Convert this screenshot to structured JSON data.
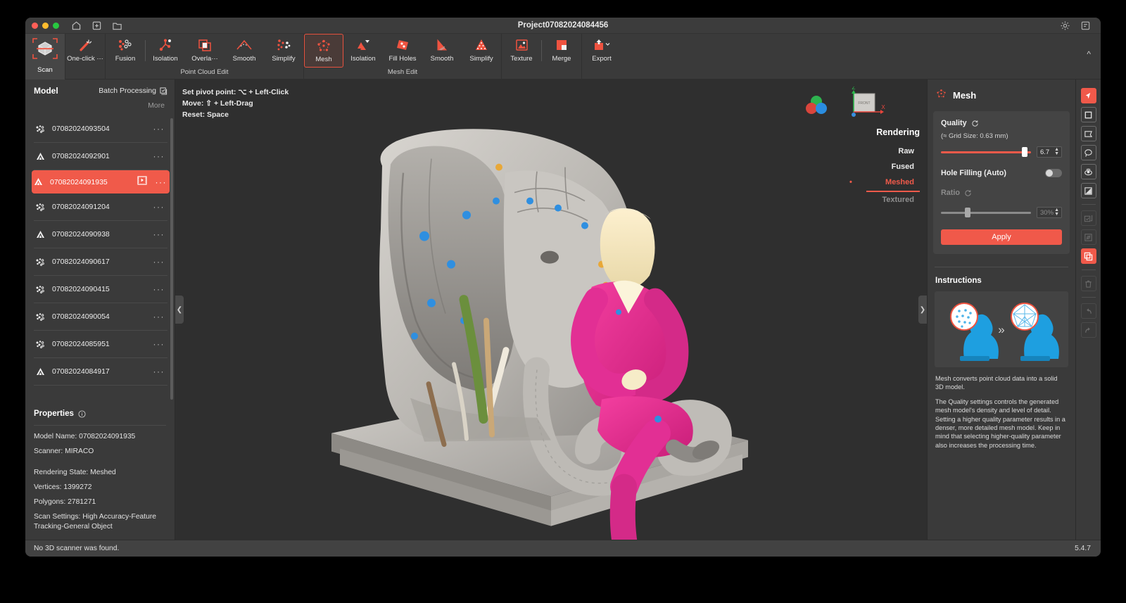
{
  "titlebar": {
    "project_title": "Project07082024084456",
    "icons": [
      "home-icon",
      "add-icon",
      "folder-icon"
    ],
    "right_icons": [
      "gear-icon",
      "note-icon"
    ]
  },
  "ribbon": {
    "scan": {
      "label": "Scan",
      "icon": "scan-cube-icon"
    },
    "groups": [
      {
        "caption": "",
        "items": [
          {
            "label": "One-click ···",
            "icon": "magic-wand-icon"
          }
        ]
      },
      {
        "caption": "Point Cloud Edit",
        "items": [
          {
            "label": "Fusion",
            "icon": "point-fusion-icon"
          },
          {
            "label": "Isolation",
            "icon": "point-isolation-icon"
          },
          {
            "label": "Overla···",
            "icon": "overlap-icon"
          },
          {
            "label": "Smooth",
            "icon": "smooth-curve-icon"
          },
          {
            "label": "Simplify",
            "icon": "simplify-dots-icon"
          }
        ]
      },
      {
        "caption": "Mesh Edit",
        "items": [
          {
            "label": "Mesh",
            "icon": "mesh-node-icon",
            "selected": true
          },
          {
            "label": "Isolation",
            "icon": "mesh-isolation-icon"
          },
          {
            "label": "Fill Holes",
            "icon": "fill-holes-icon"
          },
          {
            "label": "Smooth",
            "icon": "mesh-smooth-icon"
          },
          {
            "label": "Simplify",
            "icon": "mesh-simplify-icon"
          }
        ]
      },
      {
        "caption": "",
        "items": [
          {
            "label": "Texture",
            "icon": "texture-image-icon"
          },
          {
            "label": "Merge",
            "icon": "merge-squares-icon"
          }
        ]
      },
      {
        "caption": "",
        "items": [
          {
            "label": "Export",
            "icon": "export-upload-icon"
          }
        ]
      }
    ],
    "collapse_icon": "chevron-up-icon"
  },
  "left_panel": {
    "title": "Model",
    "batch_label": "Batch Processing",
    "batch_icon": "batch-copy-icon",
    "more_label": "More",
    "models": [
      {
        "name": "07082024093504",
        "type": "point-cloud-icon",
        "selected": false
      },
      {
        "name": "07082024092901",
        "type": "mesh-triangle-icon",
        "selected": false
      },
      {
        "name": "07082024091935",
        "type": "mesh-triangle-icon",
        "selected": true,
        "badge": "video-frame-icon"
      },
      {
        "name": "07082024091204",
        "type": "point-cloud-icon",
        "selected": false
      },
      {
        "name": "07082024090938",
        "type": "mesh-triangle-icon",
        "selected": false
      },
      {
        "name": "07082024090617",
        "type": "point-cloud-icon",
        "selected": false
      },
      {
        "name": "07082024090415",
        "type": "point-cloud-icon",
        "selected": false
      },
      {
        "name": "07082024090054",
        "type": "point-cloud-icon",
        "selected": false
      },
      {
        "name": "07082024085951",
        "type": "point-cloud-icon",
        "selected": false
      },
      {
        "name": "07082024084917",
        "type": "mesh-triangle-icon",
        "selected": false
      }
    ],
    "row_menu": "···",
    "properties": {
      "heading": "Properties",
      "info_icon": "info-icon",
      "fields": [
        {
          "key": "Model Name:",
          "value": "07082024091935"
        },
        {
          "key": "Scanner:",
          "value": "MIRACO"
        },
        {
          "key": "Rendering State:",
          "value": "Meshed"
        },
        {
          "key": "Vertices:",
          "value": "1399272"
        },
        {
          "key": "Polygons:",
          "value": "2781271"
        },
        {
          "key": "Scan Settings:",
          "value": "High Accuracy-Feature Tracking-General Object"
        }
      ]
    }
  },
  "viewport": {
    "hints": [
      "Set pivot point:  ⌥ + Left-Click",
      "Move: ⇧ + Left-Drag",
      "Reset: Space"
    ],
    "axis_labels": {
      "z": "Z",
      "x": "X",
      "face": "FRONT"
    },
    "rendering": {
      "title": "Rendering",
      "states": [
        {
          "label": "Raw",
          "state": "normal"
        },
        {
          "label": "Fused",
          "state": "normal"
        },
        {
          "label": "Meshed",
          "state": "selected"
        },
        {
          "label": "Textured",
          "state": "disabled"
        }
      ]
    },
    "collapse_left_icon": "chevron-left-icon",
    "collapse_right_icon": "chevron-right-icon"
  },
  "right_panel": {
    "title": "Mesh",
    "title_icon": "mesh-node-icon",
    "quality": {
      "label": "Quality",
      "reset_icon": "reset-circular-icon",
      "grid_note": "(≈ Grid Size: 0.63 mm)",
      "value": "6.7",
      "slider_percent": 93
    },
    "hole_filling": {
      "label": "Hole Filling (Auto)",
      "enabled": false
    },
    "ratio": {
      "label": "Ratio",
      "reset_icon": "reset-circular-icon",
      "value": "30%",
      "slider_percent": 30,
      "disabled": true
    },
    "apply_label": "Apply",
    "instructions": {
      "heading": "Instructions",
      "diagram_icon": "pointcloud-to-mesh-diagram",
      "arrow": "»",
      "paragraphs": [
        "Mesh converts point cloud data into a solid 3D model.",
        "The Quality settings controls the generated mesh model's density and level of detail. Setting a higher quality parameter results in a denser, more detailed mesh model. Keep in mind that selecting higher-quality parameter also increases the processing time."
      ]
    }
  },
  "rail": {
    "items": [
      {
        "icon": "cursor-select-icon",
        "state": "active"
      },
      {
        "icon": "rect-select-icon",
        "state": "normal"
      },
      {
        "icon": "polygon-select-icon",
        "state": "normal"
      },
      {
        "icon": "lasso-select-icon",
        "state": "normal"
      },
      {
        "icon": "through-select-icon",
        "state": "normal"
      },
      {
        "icon": "contrast-shade-icon",
        "state": "normal"
      },
      {
        "icon": "select-all-icon",
        "state": "disabled"
      },
      {
        "icon": "invert-select-icon",
        "state": "disabled"
      },
      {
        "icon": "duplicate-layers-icon",
        "state": "active"
      },
      {
        "icon": "delete-trash-icon",
        "state": "disabled"
      },
      {
        "icon": "undo-arrow-icon",
        "state": "disabled"
      },
      {
        "icon": "redo-arrow-icon",
        "state": "disabled"
      }
    ]
  },
  "status_bar": {
    "message": "No 3D scanner was found.",
    "version": "5.4.7"
  },
  "colors": {
    "accent": "#f0594a",
    "panel": "#3a3a3a",
    "card": "#444444",
    "viewport": "#2f2f2f"
  }
}
